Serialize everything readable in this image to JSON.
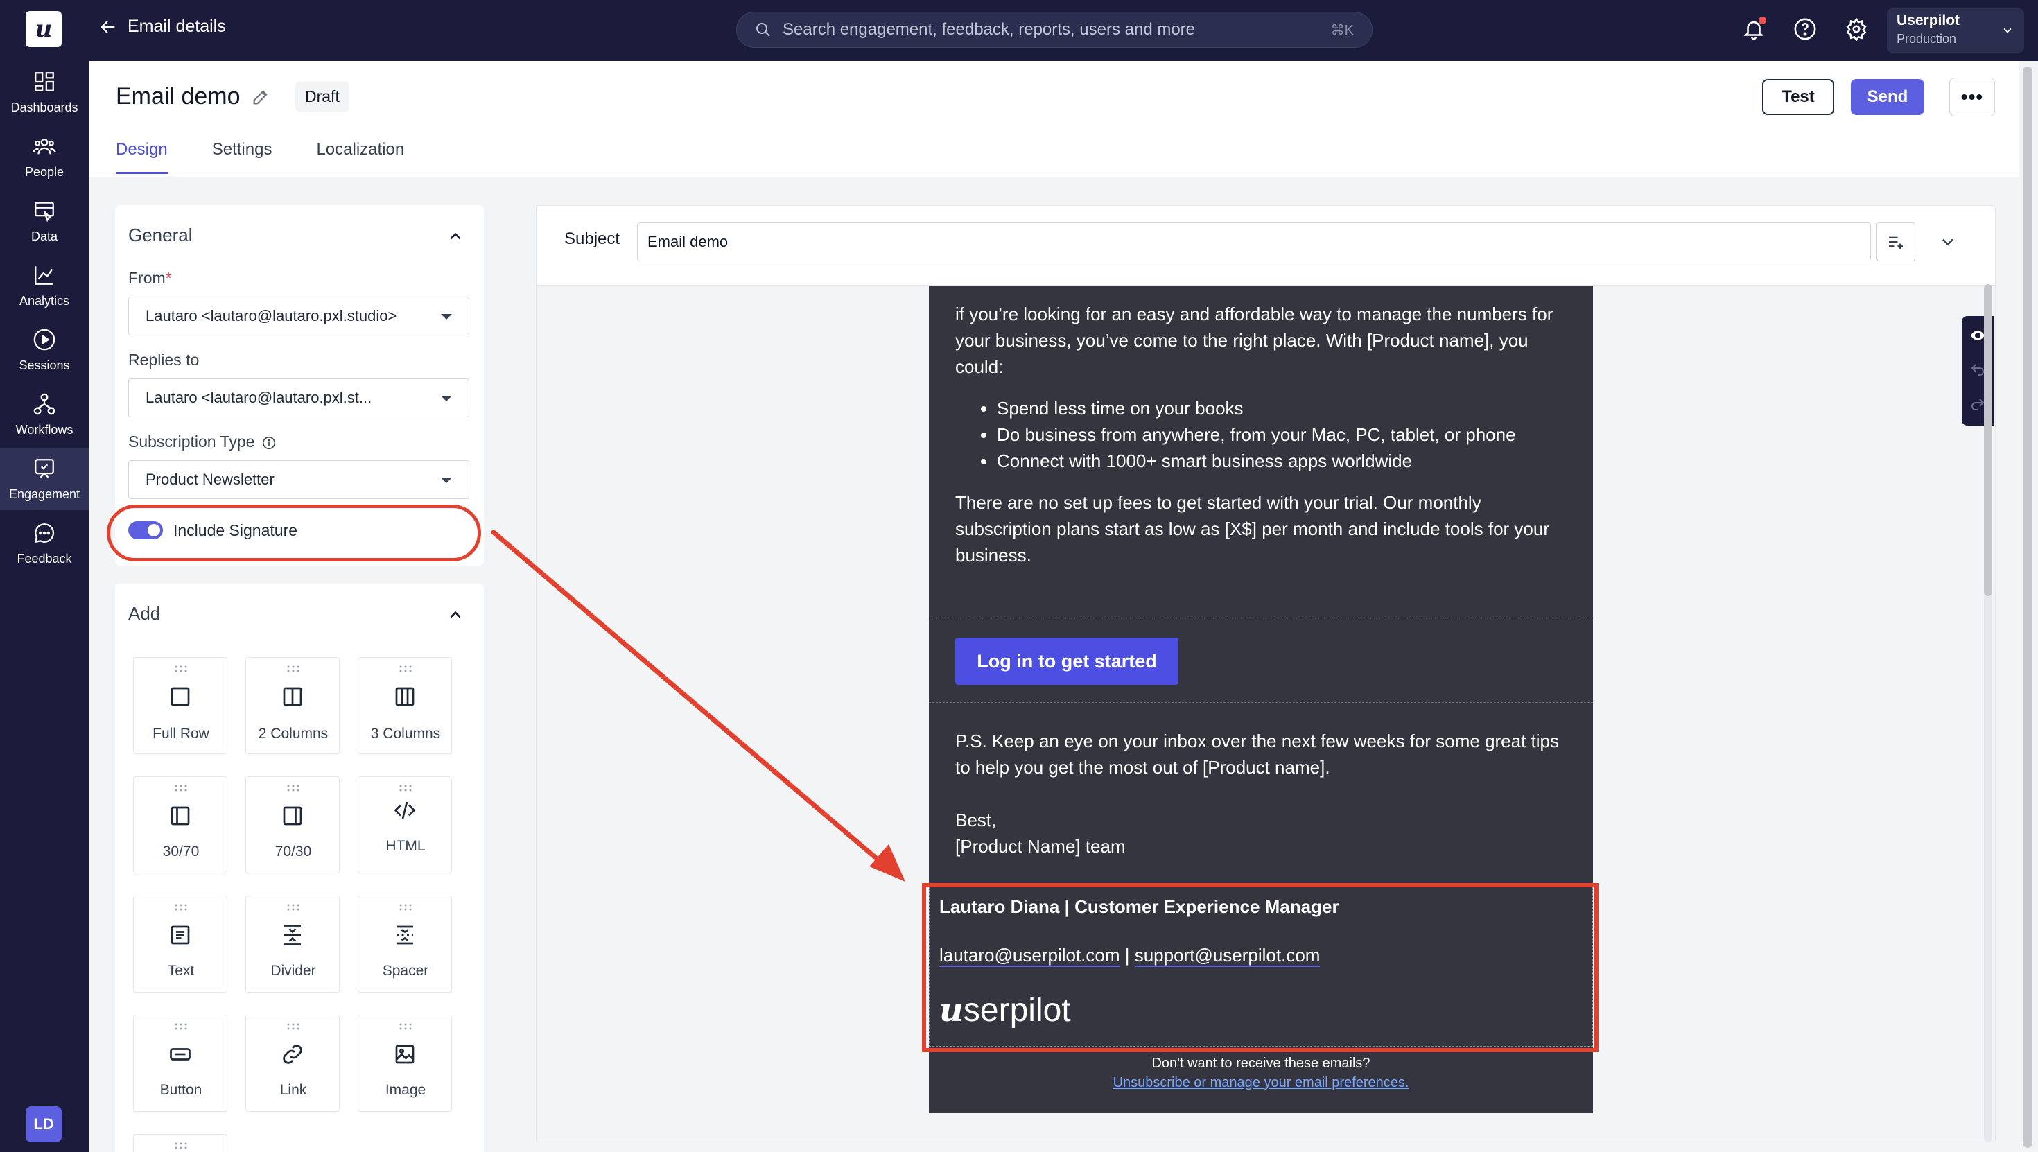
{
  "topbar": {
    "back_label": "Email details",
    "search_placeholder": "Search engagement, feedback, reports, users and more",
    "search_shortcut": "⌘K",
    "account_name": "Userpilot",
    "account_env": "Production"
  },
  "logo_letter": "u",
  "nav": [
    {
      "label": "Dashboards",
      "icon": "dashboard-icon"
    },
    {
      "label": "People",
      "icon": "people-icon"
    },
    {
      "label": "Data",
      "icon": "data-icon"
    },
    {
      "label": "Analytics",
      "icon": "analytics-icon"
    },
    {
      "label": "Sessions",
      "icon": "sessions-icon"
    },
    {
      "label": "Workflows",
      "icon": "workflows-icon"
    },
    {
      "label": "Engagement",
      "icon": "engagement-icon",
      "active": true
    },
    {
      "label": "Feedback",
      "icon": "feedback-icon"
    }
  ],
  "user_initials": "LD",
  "header": {
    "title": "Email demo",
    "status": "Draft",
    "tabs": [
      "Design",
      "Settings",
      "Localization"
    ],
    "active_tab": "Design",
    "test_label": "Test",
    "send_label": "Send",
    "more_label": "•••"
  },
  "general": {
    "title": "General",
    "from_label": "From",
    "from_required": "*",
    "from_value": "Lautaro <lautaro@lautaro.pxl.studio>",
    "replies_label": "Replies to",
    "replies_value": "Lautaro <lautaro@lautaro.pxl.st...",
    "subscription_label": "Subscription Type",
    "subscription_value": "Product Newsletter",
    "signature_label": "Include Signature",
    "signature_enabled": true
  },
  "add": {
    "title": "Add",
    "blocks": [
      "Full Row",
      "2 Columns",
      "3 Columns",
      "30/70",
      "70/30",
      "HTML",
      "Text",
      "Divider",
      "Spacer",
      "Button",
      "Link",
      "Image"
    ]
  },
  "editor": {
    "subject_label": "Subject",
    "subject_value": "Email demo"
  },
  "email": {
    "intro": "if you’re looking for an easy and affordable way to manage the numbers for your business, you’ve come to the right place. With [Product name], you could:",
    "bullets": [
      "Spend less time on your books",
      "Do business from anywhere, from your Mac, PC, tablet, or phone",
      "Connect with 1000+ smart business apps worldwide"
    ],
    "pricing": "There are no set up fees to get started with your trial. Our monthly subscription plans start as low as [X$] per month and include tools for your business.",
    "cta": "Log in to get started",
    "ps": "P.S. Keep an eye on your inbox over the next few weeks for some great tips to help you get the most out of [Product name].",
    "closing": "Best,",
    "team": "[Product Name] team",
    "signature_name": "Lautaro Diana | Customer Experience Manager",
    "signature_email1": "lautaro@userpilot.com",
    "signature_sep": " | ",
    "signature_email2": "support@userpilot.com",
    "signature_logo_u": "u",
    "signature_logo_rest": "serpilot",
    "footer_question": "Don't want to receive these emails?",
    "footer_link": "Unsubscribe or manage your email preferences."
  },
  "colors": {
    "nav_bg": "#1b1c3b",
    "accent": "#5b5fe0",
    "annotation": "#e3412f",
    "email_bg": "#35353f"
  }
}
